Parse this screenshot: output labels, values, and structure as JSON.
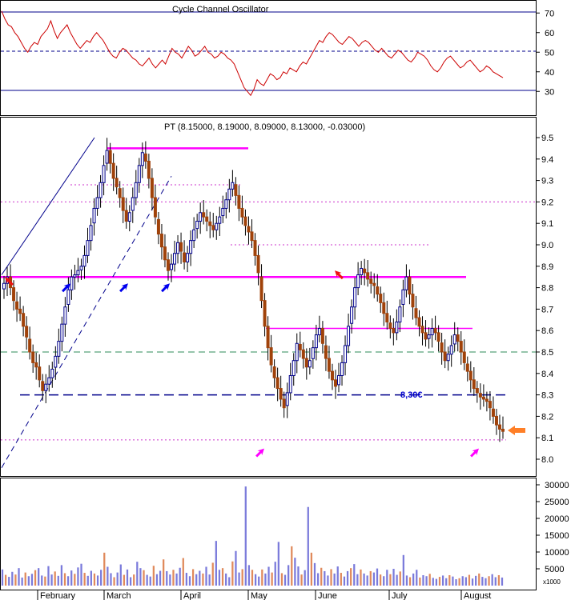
{
  "chart_data": [
    {
      "type": "line",
      "panel": "oscillator",
      "title": "Cycle Channel Oscillator",
      "y_ticks": [
        30,
        40,
        50,
        60,
        70
      ],
      "ylim": [
        20,
        75
      ],
      "reference_lines": [
        {
          "value": 70.5,
          "style": "solid",
          "color": "#00008b"
        },
        {
          "value": 50.5,
          "style": "dashed",
          "color": "#00008b"
        },
        {
          "value": 30.5,
          "style": "solid",
          "color": "#00008b"
        }
      ],
      "series_color": "#cc0000",
      "values": [
        71,
        67,
        64,
        63,
        60,
        58,
        55,
        52,
        50,
        53,
        55,
        54,
        58,
        60,
        62,
        66,
        61,
        57,
        60,
        62,
        64,
        60,
        57,
        54,
        52,
        54,
        56,
        55,
        58,
        60,
        58,
        56,
        53,
        50,
        48,
        47,
        50,
        52,
        51,
        49,
        47,
        46,
        44,
        43,
        45,
        47,
        44,
        42,
        44,
        46,
        44,
        48,
        52,
        50,
        49,
        47,
        50,
        53,
        51,
        48,
        49,
        51,
        53,
        50,
        49,
        47,
        48,
        50,
        49,
        47,
        46,
        44,
        40,
        36,
        32,
        30,
        28,
        31,
        36,
        34,
        33,
        36,
        39,
        38,
        36,
        37,
        40,
        39,
        42,
        41,
        40,
        43,
        45,
        44,
        47,
        50,
        53,
        56,
        55,
        58,
        60,
        59,
        57,
        55,
        54,
        56,
        58,
        57,
        55,
        53,
        55,
        56,
        55,
        53,
        51,
        50,
        52,
        50,
        48,
        47,
        49,
        51,
        50,
        48,
        46,
        45,
        47,
        50,
        49,
        48,
        46,
        43,
        41,
        40,
        42,
        45,
        47,
        48,
        46,
        44,
        42,
        43,
        45,
        46,
        44,
        42,
        40,
        41,
        43,
        42,
        40,
        39,
        38,
        37
      ]
    },
    {
      "type": "candlestick",
      "panel": "price",
      "title": "PT (8.15000, 8.19000, 8.09000, 8.13000, -0.03000)",
      "y_ticks": [
        "8.0",
        "8.1",
        "8.2",
        "8.3",
        "8.4",
        "8.5",
        "8.6",
        "8.7",
        "8.8",
        "8.9",
        "9.0",
        "9.1",
        "9.2",
        "9.3",
        "9.4",
        "9.5"
      ],
      "ylim": [
        7.95,
        9.55
      ],
      "x_ticks": [
        "February",
        "March",
        "April",
        "May",
        "June",
        "July",
        "August"
      ],
      "up_color": "#00008b",
      "down_color": "#a0420a",
      "annotation": "8,30€",
      "closes": [
        8.82,
        8.85,
        8.8,
        8.74,
        8.7,
        8.68,
        8.62,
        8.57,
        8.5,
        8.45,
        8.43,
        8.37,
        8.32,
        8.35,
        8.38,
        8.42,
        8.48,
        8.55,
        8.63,
        8.71,
        8.79,
        8.85,
        8.86,
        8.88,
        8.9,
        8.95,
        9.02,
        9.09,
        9.17,
        9.22,
        9.29,
        9.37,
        9.44,
        9.38,
        9.31,
        9.27,
        9.22,
        9.16,
        9.11,
        9.15,
        9.22,
        9.29,
        9.37,
        9.43,
        9.39,
        9.31,
        9.22,
        9.13,
        9.05,
        8.99,
        8.93,
        8.88,
        8.91,
        8.96,
        9.01,
        8.97,
        8.92,
        8.96,
        9.02,
        9.07,
        9.11,
        9.15,
        9.13,
        9.11,
        9.09,
        9.07,
        9.1,
        9.13,
        9.17,
        9.21,
        9.26,
        9.29,
        9.23,
        9.17,
        9.13,
        9.09,
        9.06,
        9.02,
        8.95,
        8.87,
        8.74,
        8.62,
        8.52,
        8.44,
        8.38,
        8.33,
        8.28,
        8.24,
        8.31,
        8.39,
        8.46,
        8.54,
        8.51,
        8.47,
        8.43,
        8.46,
        8.52,
        8.58,
        8.61,
        8.54,
        8.47,
        8.41,
        8.37,
        8.34,
        8.39,
        8.45,
        8.53,
        8.62,
        8.71,
        8.8,
        8.86,
        8.89,
        8.87,
        8.84,
        8.82,
        8.81,
        8.77,
        8.73,
        8.68,
        8.64,
        8.61,
        8.59,
        8.64,
        8.71,
        8.79,
        8.85,
        8.77,
        8.71,
        8.66,
        8.62,
        8.59,
        8.56,
        8.58,
        8.61,
        8.59,
        8.55,
        8.5,
        8.46,
        8.49,
        8.53,
        8.58,
        8.55,
        8.5,
        8.45,
        8.41,
        8.37,
        8.33,
        8.31,
        8.29,
        8.28,
        8.27,
        8.24,
        8.2,
        8.16,
        8.14,
        8.13
      ]
    },
    {
      "type": "bar",
      "panel": "volume",
      "y_ticks": [
        "5000",
        "10000",
        "15000",
        "20000",
        "25000",
        "30000"
      ],
      "ylim": [
        0,
        32000
      ],
      "unit_label": "x1000",
      "values": [
        4800,
        3200,
        2600,
        4100,
        3300,
        5200,
        2400,
        3900,
        2800,
        3500,
        4600,
        5200,
        3000,
        2700,
        5800,
        3300,
        4200,
        2900,
        6100,
        3700,
        2800,
        4500,
        3500,
        5400,
        6500,
        3800,
        2900,
        4400,
        3600,
        3000,
        4700,
        9800,
        5600,
        3700,
        2500,
        3900,
        6300,
        3200,
        4800,
        2500,
        3300,
        7100,
        5200,
        4600,
        3200,
        2700,
        5900,
        3400,
        4400,
        7800,
        4300,
        3300,
        4700,
        3600,
        5300,
        8200,
        3800,
        2800,
        4900,
        3400,
        4400,
        3600,
        5600,
        3300,
        6800,
        13300,
        4700,
        5200,
        3600,
        2500,
        7200,
        10300,
        3900,
        4900,
        29500,
        6100,
        4700,
        3400,
        2700,
        4800,
        3600,
        5600,
        3900,
        7100,
        13000,
        3700,
        3200,
        6100,
        11700,
        8300,
        5700,
        3300,
        4600,
        23400,
        9800,
        6700,
        3700,
        5300,
        4300,
        3000,
        4900,
        3600,
        5700,
        3800,
        2700,
        4300,
        5200,
        6400,
        3400,
        4800,
        3600,
        3000,
        4300,
        3900,
        5100,
        3300,
        2800,
        4700,
        3400,
        5000,
        3200,
        4200,
        9100,
        3000,
        2500,
        3600,
        4700,
        2400,
        3100,
        2800,
        3500,
        2300,
        2000,
        2600,
        3000,
        2200,
        3100,
        2700,
        1900,
        2200,
        2800,
        2500,
        3200,
        2100,
        2900,
        3600,
        2600,
        2200,
        2800,
        3400,
        2500,
        3100,
        2400
      ]
    }
  ]
}
